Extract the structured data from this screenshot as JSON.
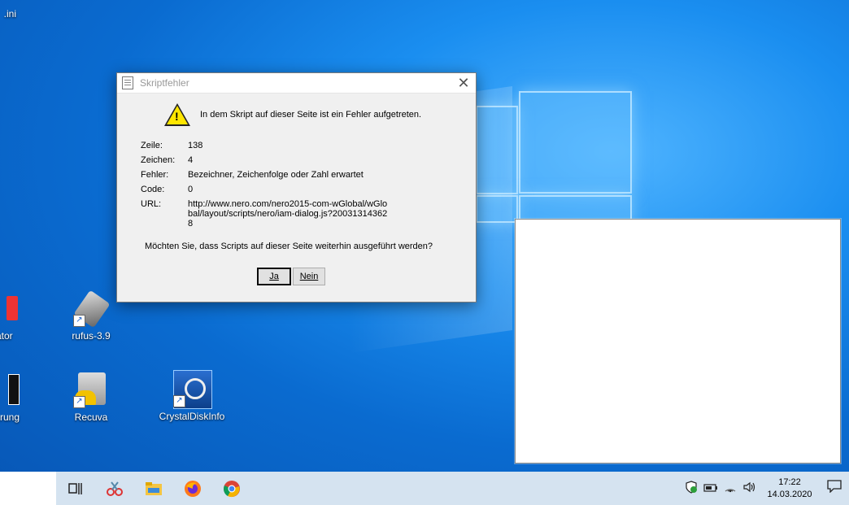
{
  "desktop": {
    "top_file_label": ".ini",
    "icons": [
      {
        "label": "reator"
      },
      {
        "label": "rufus-3.9"
      },
      {
        "label": "orderung"
      },
      {
        "label": "Recuva"
      },
      {
        "label": "CrystalDiskInfo"
      }
    ]
  },
  "dialog": {
    "title": "Skriptfehler",
    "message": "In dem Skript auf dieser Seite ist ein Fehler aufgetreten.",
    "fields": [
      {
        "label": "Zeile:",
        "value": "138"
      },
      {
        "label": "Zeichen:",
        "value": "4"
      },
      {
        "label": "Fehler:",
        "value": "Bezeichner, Zeichenfolge oder Zahl erwartet"
      },
      {
        "label": "Code:",
        "value": "0"
      },
      {
        "label": "URL:",
        "value": "http://www.nero.com/nero2015-com-wGlobal/wGlobal/layout/scripts/nero/iam-dialog.js?200313143628"
      }
    ],
    "question": "Möchten Sie, dass Scripts auf dieser Seite weiterhin ausgeführt werden?",
    "yes_label": "Ja",
    "no_label": "Nein"
  },
  "taskbar": {
    "icons": [
      "task-view-icon",
      "snipping-tool-icon",
      "file-explorer-icon",
      "firefox-icon",
      "chrome-icon"
    ],
    "tray_icons": [
      "defender-icon",
      "battery-icon",
      "network-icon",
      "volume-icon"
    ],
    "time": "17:22",
    "date": "14.03.2020"
  },
  "colors": {
    "desktop_blue": "#0a6bd0",
    "taskbar_bg": "#d5e3f0",
    "warning_yellow": "#ffe600"
  }
}
